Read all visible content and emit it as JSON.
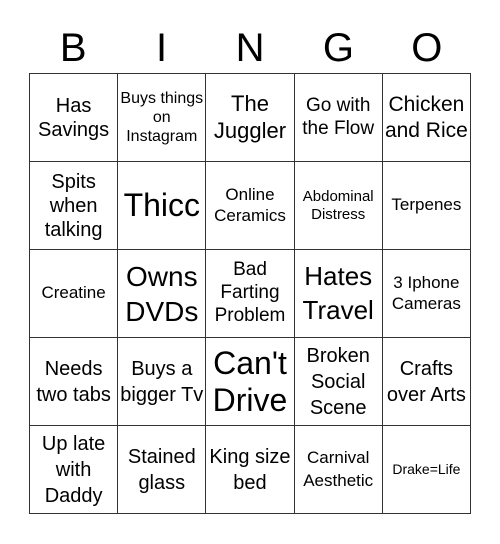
{
  "header": [
    "B",
    "I",
    "N",
    "G",
    "O"
  ],
  "cells": [
    "Has Savings",
    "Buys things on Instagram",
    "The Juggler",
    "Go with the Flow",
    "Chicken and Rice",
    "Spits when talking",
    "Thicc",
    "Online Ceramics",
    "Abdominal Distress",
    "Terpenes",
    "Creatine",
    "Owns DVDs",
    "Bad Farting Problem",
    "Hates Travel",
    "3 Iphone Cameras",
    "Needs two tabs",
    "Buys a bigger Tv",
    "Can't Drive",
    "Broken Social Scene",
    "Crafts over Arts",
    "Up late with Daddy",
    "Stained glass",
    "King size bed",
    "Carnival Aesthetic",
    "Drake=Life"
  ]
}
